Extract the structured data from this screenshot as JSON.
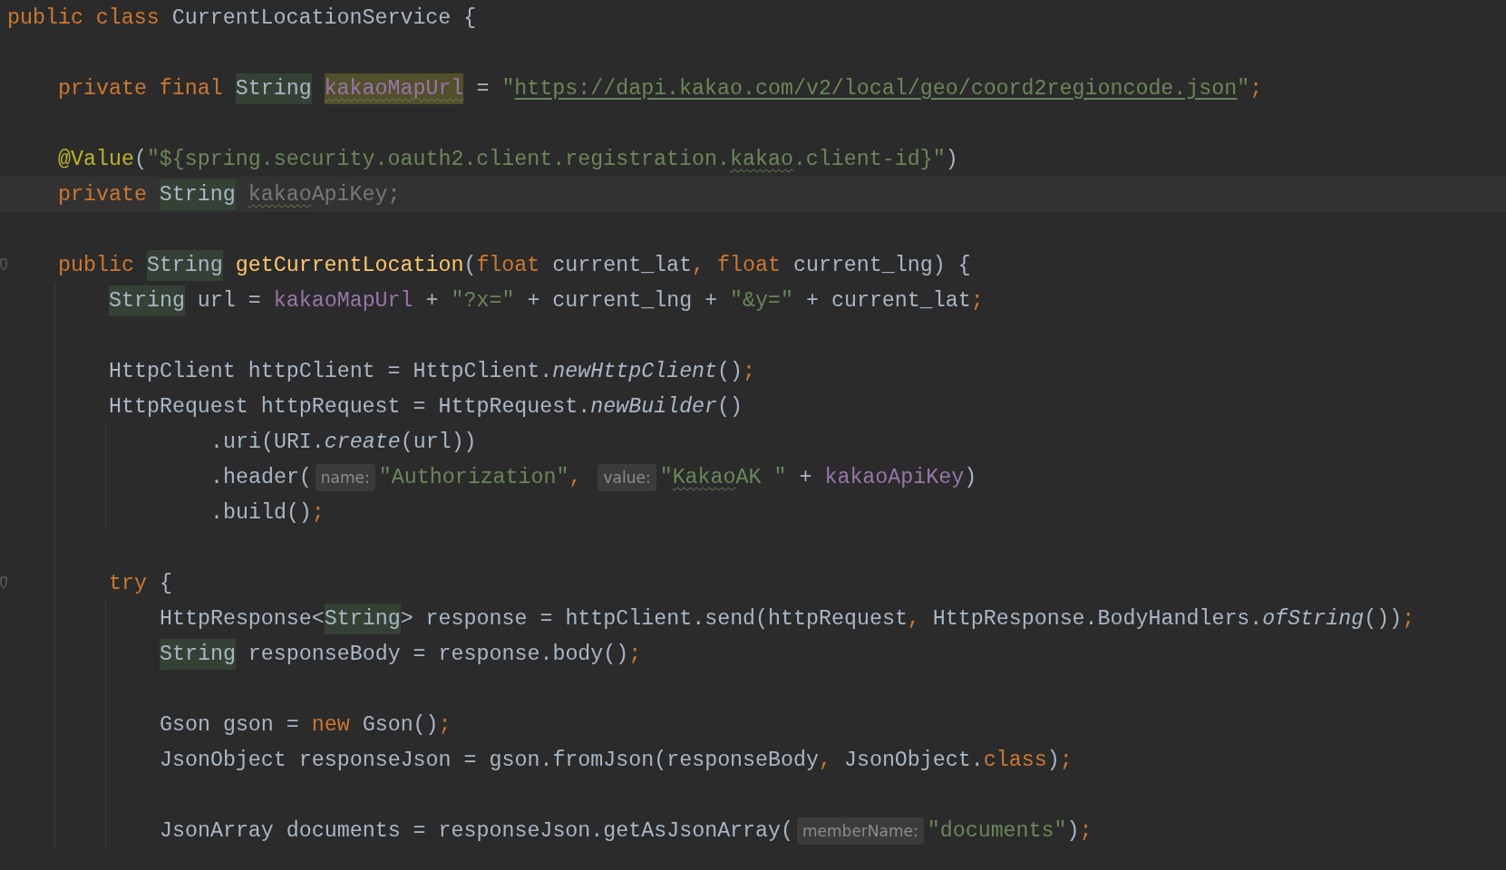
{
  "editor": {
    "lines": [
      {
        "kind": "code",
        "tokens": [
          {
            "kind": "keyword",
            "text": "public class "
          },
          {
            "kind": "plain",
            "text": "CurrentLocationService {"
          }
        ],
        "children": [
          {
            "kind": "code",
            "gap_before": true,
            "tokens": [
              {
                "kind": "keyword",
                "text": "private final "
              },
              {
                "kind": "plain",
                "text": "String",
                "highlighted": true
              },
              {
                "kind": "field",
                "text": "kakaoMapUrl",
                "highlighted": true,
                "write_access": true,
                "typo": true
              },
              {
                "kind": "plain",
                "text": " = "
              },
              {
                "kind": "string",
                "text": "\""
              },
              {
                "kind": "url",
                "text": "https://dapi.kakao.com/v2/local/geo/coord2regioncode.json"
              },
              {
                "kind": "string",
                "text": "\""
              },
              {
                "kind": "punct",
                "text": ";"
              }
            ]
          },
          {
            "kind": "code",
            "gap_before": true,
            "tokens": [
              {
                "kind": "annotation",
                "text": "@Value"
              },
              {
                "kind": "plain",
                "text": "("
              },
              {
                "kind": "string",
                "text": "\"${spring.security.oauth2.client.registration."
              },
              {
                "kind": "string",
                "text": "kakao",
                "typo": true
              },
              {
                "kind": "string",
                "text": ".client-id}\""
              },
              {
                "kind": "plain",
                "text": ")"
              }
            ]
          },
          {
            "kind": "code",
            "current": true,
            "tokens": [
              {
                "kind": "keyword",
                "text": "private "
              },
              {
                "kind": "plain",
                "text": "String",
                "highlighted": true,
                "caret": true
              },
              {
                "kind": "unused",
                "text": "kakao",
                "typo": true
              },
              {
                "kind": "unused",
                "text": "ApiKey;"
              }
            ]
          },
          {
            "kind": "code",
            "gap_before": true,
            "foldable": true,
            "tokens": [
              {
                "kind": "keyword",
                "text": "public "
              },
              {
                "kind": "plain",
                "text": "String",
                "highlighted": true
              },
              {
                "kind": "method",
                "text": " getCurrentLocation"
              },
              {
                "kind": "plain",
                "text": "("
              },
              {
                "kind": "keyword",
                "text": "float "
              },
              {
                "kind": "plain",
                "text": "current_lat"
              },
              {
                "kind": "punct",
                "text": ", "
              },
              {
                "kind": "keyword",
                "text": "float "
              },
              {
                "kind": "plain",
                "text": "current_lng) {"
              }
            ],
            "children": [
              {
                "kind": "code",
                "tokens": [
                  {
                    "kind": "plain",
                    "text": "String",
                    "highlighted": true
                  },
                  {
                    "kind": "plain",
                    "text": " url = "
                  },
                  {
                    "kind": "field",
                    "text": "kakaoMapUrl"
                  },
                  {
                    "kind": "plain",
                    "text": " + "
                  },
                  {
                    "kind": "string",
                    "text": "\"?x=\""
                  },
                  {
                    "kind": "plain",
                    "text": " + current_lng + "
                  },
                  {
                    "kind": "string",
                    "text": "\"&y=\""
                  },
                  {
                    "kind": "plain",
                    "text": " + current_lat"
                  },
                  {
                    "kind": "punct",
                    "text": ";"
                  }
                ]
              },
              {
                "kind": "code",
                "gap_before": true,
                "tokens": [
                  {
                    "kind": "plain",
                    "text": "HttpClient httpClient = HttpClient."
                  },
                  {
                    "kind": "static",
                    "text": "newHttpClient"
                  },
                  {
                    "kind": "plain",
                    "text": "()"
                  },
                  {
                    "kind": "punct",
                    "text": ";"
                  }
                ]
              },
              {
                "kind": "code",
                "tokens": [
                  {
                    "kind": "plain",
                    "text": "HttpRequest httpRequest = HttpRequest."
                  },
                  {
                    "kind": "static",
                    "text": "newBuilder"
                  },
                  {
                    "kind": "plain",
                    "text": "()"
                  }
                ],
                "children": [
                  {
                    "kind": "continuation",
                    "tokens": [
                      {
                        "kind": "plain",
                        "text": ".uri(URI."
                      },
                      {
                        "kind": "static",
                        "text": "create"
                      },
                      {
                        "kind": "plain",
                        "text": "(url))"
                      }
                    ]
                  },
                  {
                    "kind": "continuation",
                    "tokens": [
                      {
                        "kind": "plain",
                        "text": ".header("
                      },
                      {
                        "kind": "hint",
                        "text": "name:"
                      },
                      {
                        "kind": "string",
                        "text": "\"Authorization\""
                      },
                      {
                        "kind": "punct",
                        "text": ", "
                      },
                      {
                        "kind": "hint",
                        "text": "value:"
                      },
                      {
                        "kind": "string",
                        "text": "\""
                      },
                      {
                        "kind": "string",
                        "text": "Kakao",
                        "typo": true
                      },
                      {
                        "kind": "string",
                        "text": "AK \""
                      },
                      {
                        "kind": "plain",
                        "text": " + "
                      },
                      {
                        "kind": "field",
                        "text": "kakaoApiKey"
                      },
                      {
                        "kind": "plain",
                        "text": ")"
                      }
                    ]
                  },
                  {
                    "kind": "continuation",
                    "tokens": [
                      {
                        "kind": "plain",
                        "text": ".build()"
                      },
                      {
                        "kind": "punct",
                        "text": ";"
                      }
                    ]
                  }
                ]
              },
              {
                "kind": "code",
                "gap_before": true,
                "foldable": true,
                "tokens": [
                  {
                    "kind": "keyword",
                    "text": "try"
                  },
                  {
                    "kind": "plain",
                    "text": " {"
                  }
                ],
                "children": [
                  {
                    "kind": "code",
                    "tokens": [
                      {
                        "kind": "plain",
                        "text": "HttpResponse<"
                      },
                      {
                        "kind": "plain",
                        "text": "String",
                        "highlighted": true
                      },
                      {
                        "kind": "plain",
                        "text": "> response = httpClient.send(httpRequest"
                      },
                      {
                        "kind": "punct",
                        "text": ", "
                      },
                      {
                        "kind": "plain",
                        "text": "HttpResponse.BodyHandlers."
                      },
                      {
                        "kind": "static",
                        "text": "ofString"
                      },
                      {
                        "kind": "plain",
                        "text": "())"
                      },
                      {
                        "kind": "punct",
                        "text": ";"
                      }
                    ]
                  },
                  {
                    "kind": "code",
                    "tokens": [
                      {
                        "kind": "plain",
                        "text": "String",
                        "highlighted": true
                      },
                      {
                        "kind": "plain",
                        "text": " responseBody = response.body()"
                      },
                      {
                        "kind": "punct",
                        "text": ";"
                      }
                    ]
                  },
                  {
                    "kind": "code",
                    "gap_before": true,
                    "tokens": [
                      {
                        "kind": "plain",
                        "text": "Gson gson = "
                      },
                      {
                        "kind": "keyword",
                        "text": "new "
                      },
                      {
                        "kind": "plain",
                        "text": "Gson()"
                      },
                      {
                        "kind": "punct",
                        "text": ";"
                      }
                    ]
                  },
                  {
                    "kind": "code",
                    "tokens": [
                      {
                        "kind": "plain",
                        "text": "JsonObject responseJson = gson.fromJson(responseBody"
                      },
                      {
                        "kind": "punct",
                        "text": ", "
                      },
                      {
                        "kind": "plain",
                        "text": "JsonObject."
                      },
                      {
                        "kind": "keyword",
                        "text": "class"
                      },
                      {
                        "kind": "plain",
                        "text": ")"
                      },
                      {
                        "kind": "punct",
                        "text": ";"
                      }
                    ]
                  },
                  {
                    "kind": "code",
                    "gap_before": true,
                    "tokens": [
                      {
                        "kind": "plain",
                        "text": "JsonArray documents = responseJson.getAsJsonArray("
                      },
                      {
                        "kind": "hint",
                        "text": "memberName:"
                      },
                      {
                        "kind": "string",
                        "text": "\"documents\""
                      },
                      {
                        "kind": "plain",
                        "text": ")"
                      },
                      {
                        "kind": "punct",
                        "text": ";"
                      }
                    ]
                  }
                ]
              }
            ]
          }
        ]
      }
    ]
  }
}
